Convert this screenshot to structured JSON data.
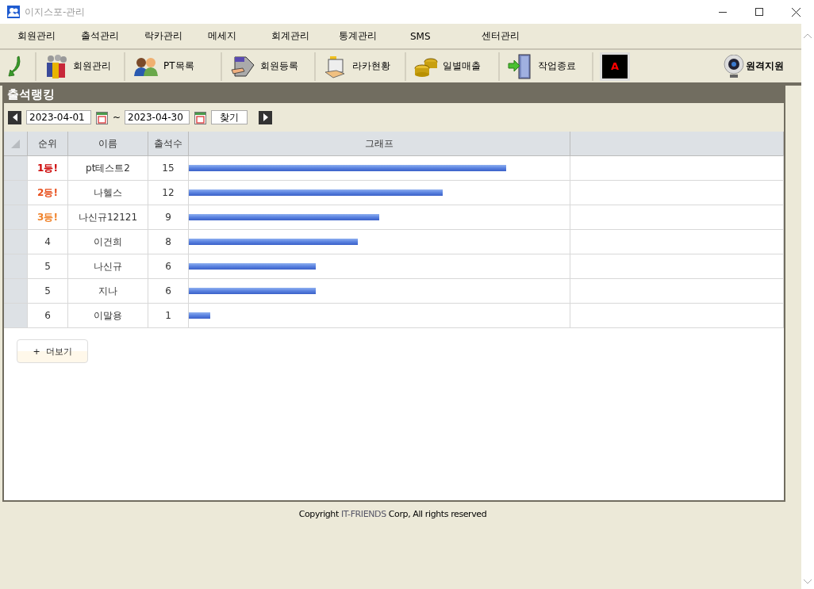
{
  "window": {
    "title": "이지스포-관리"
  },
  "menu": [
    "회원관리",
    "출석관리",
    "락카관리",
    "메세지",
    "회계관리",
    "통계관리",
    "SMS",
    "센터관리"
  ],
  "toolbar": [
    {
      "kind": "back"
    },
    {
      "kind": "members",
      "label": "회원관리"
    },
    {
      "kind": "pt",
      "label": "PT목록"
    },
    {
      "kind": "register",
      "label": "회원등록"
    },
    {
      "kind": "locker",
      "label": "라카현황"
    },
    {
      "kind": "sales",
      "label": "일별매출"
    },
    {
      "kind": "exit",
      "label": "작업종료"
    },
    {
      "kind": "badge",
      "label": "A"
    }
  ],
  "remote": {
    "label": "원격지원"
  },
  "panel": {
    "title": "출석랭킹",
    "date_from": "2023-04-01",
    "date_to": "2023-04-30",
    "separator": "~",
    "search_button": "찾기"
  },
  "table": {
    "columns": [
      "순위",
      "이름",
      "출석수",
      "그래프"
    ],
    "rows": [
      {
        "rank": "1등!",
        "color": "#cc0000",
        "name": "pt테스트2",
        "count": "15",
        "level": 0.833
      },
      {
        "rank": "2등!",
        "color": "#e8501e",
        "name": "나헬스",
        "count": "12",
        "level": 0.667
      },
      {
        "rank": "3등!",
        "color": "#f0822a",
        "name": "나신규12121",
        "count": "9",
        "level": 0.5
      },
      {
        "rank": "4",
        "name": "이건희",
        "count": "8",
        "level": 0.444
      },
      {
        "rank": "5",
        "name": "나신규",
        "count": "6",
        "level": 0.333
      },
      {
        "rank": "5",
        "name": "지나",
        "count": "6",
        "level": 0.333
      },
      {
        "rank": "6",
        "name": "이말용",
        "count": "1",
        "level": 0.056
      }
    ]
  },
  "more_button": "+  더보기",
  "footer": {
    "before": "Copyright ",
    "brand": "IT-FRIENDS",
    "after": " Corp,  All rights reserved"
  }
}
